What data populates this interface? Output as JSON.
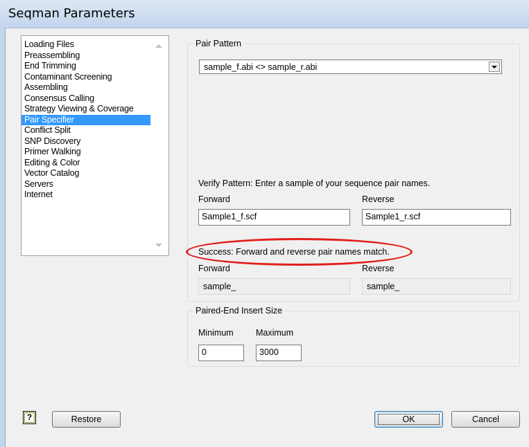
{
  "window": {
    "title": "Seqman Parameters"
  },
  "sidebar": {
    "items": [
      {
        "label": "Loading Files",
        "selected": false
      },
      {
        "label": "Preassembling",
        "selected": false
      },
      {
        "label": "End Trimming",
        "selected": false
      },
      {
        "label": "Contaminant Screening",
        "selected": false
      },
      {
        "label": "Assembling",
        "selected": false
      },
      {
        "label": "Consensus Calling",
        "selected": false
      },
      {
        "label": "Strategy Viewing & Coverage",
        "selected": false
      },
      {
        "label": "Pair Specifier",
        "selected": true
      },
      {
        "label": "Conflict Split",
        "selected": false
      },
      {
        "label": "SNP Discovery",
        "selected": false
      },
      {
        "label": "Primer Walking",
        "selected": false
      },
      {
        "label": "Editing & Color",
        "selected": false
      },
      {
        "label": "Vector Catalog",
        "selected": false
      },
      {
        "label": "Servers",
        "selected": false
      },
      {
        "label": "Internet",
        "selected": false
      }
    ]
  },
  "pair_pattern": {
    "legend": "Pair Pattern",
    "selected": "sample_f.abi <> sample_r.abi",
    "verify_text": "Verify Pattern: Enter a sample of your sequence pair names.",
    "forward_label": "Forward",
    "reverse_label": "Reverse",
    "forward_value": "Sample1_f.scf",
    "reverse_value": "Sample1_r.scf",
    "status": "Success:  Forward and reverse pair names match.",
    "result_forward_label": "Forward",
    "result_reverse_label": "Reverse",
    "result_forward": "sample_",
    "result_reverse": "sample_"
  },
  "insert_size": {
    "legend": "Paired-End Insert Size",
    "min_label": "Minimum",
    "max_label": "Maximum",
    "min_value": "0",
    "max_value": "3000"
  },
  "buttons": {
    "help": "?",
    "restore": "Restore",
    "ok": "OK",
    "cancel": "Cancel"
  },
  "colors": {
    "selection": "#3399ff",
    "annotation_ellipse": "#e0201b"
  }
}
